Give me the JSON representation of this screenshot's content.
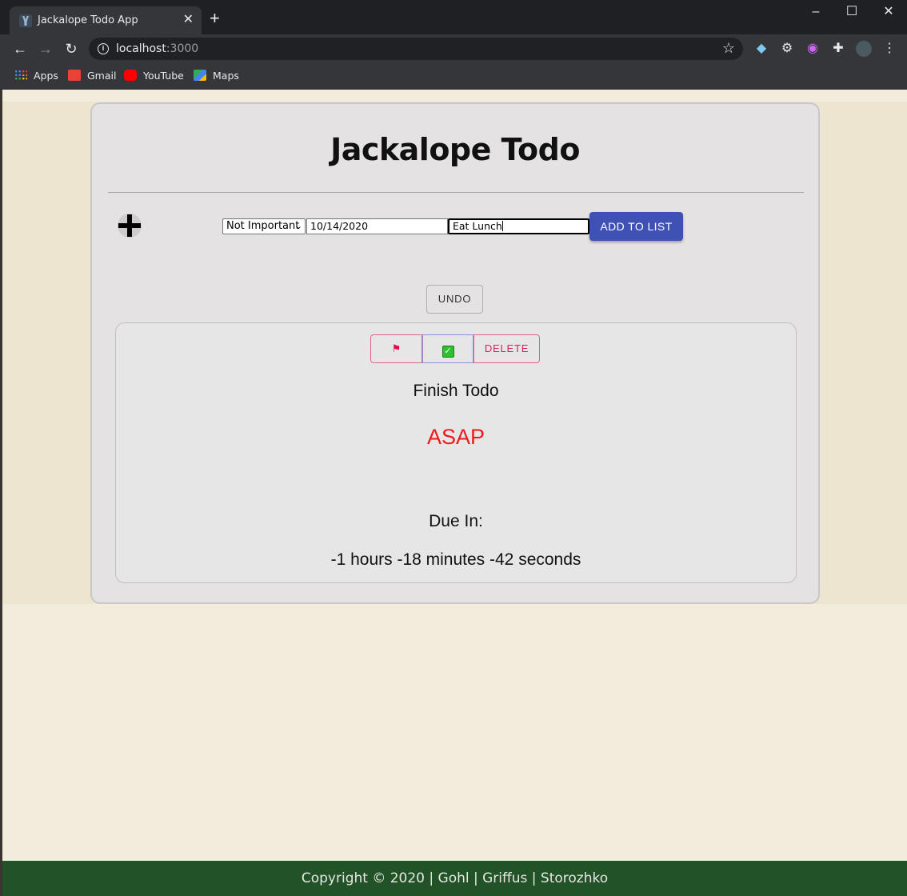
{
  "browser": {
    "tab_title": "Jackalope Todo App",
    "url_host": "localhost",
    "url_port": ":3000",
    "bookmarks": [
      "Apps",
      "Gmail",
      "YouTube",
      "Maps"
    ]
  },
  "app": {
    "title": "Jackalope Todo"
  },
  "form": {
    "priority_selected": "Not Important",
    "date_value": "10/14/2020",
    "task_value": "Eat Lunch",
    "add_label": "ADD TO LIST"
  },
  "undo_label": "UNDO",
  "todo": {
    "delete_label": "DELETE",
    "task": "Finish Todo",
    "priority": "ASAP",
    "due_label": "Due In:",
    "due_value": "-1 hours -18 minutes -42 seconds"
  },
  "footer": {
    "text": "Copyright © 2020 | Gohl | Griffus | Storozhko"
  },
  "colors": {
    "accent": "#3f51b5",
    "priority_asap": "#ef1a1a",
    "footer_bg": "#215326"
  }
}
